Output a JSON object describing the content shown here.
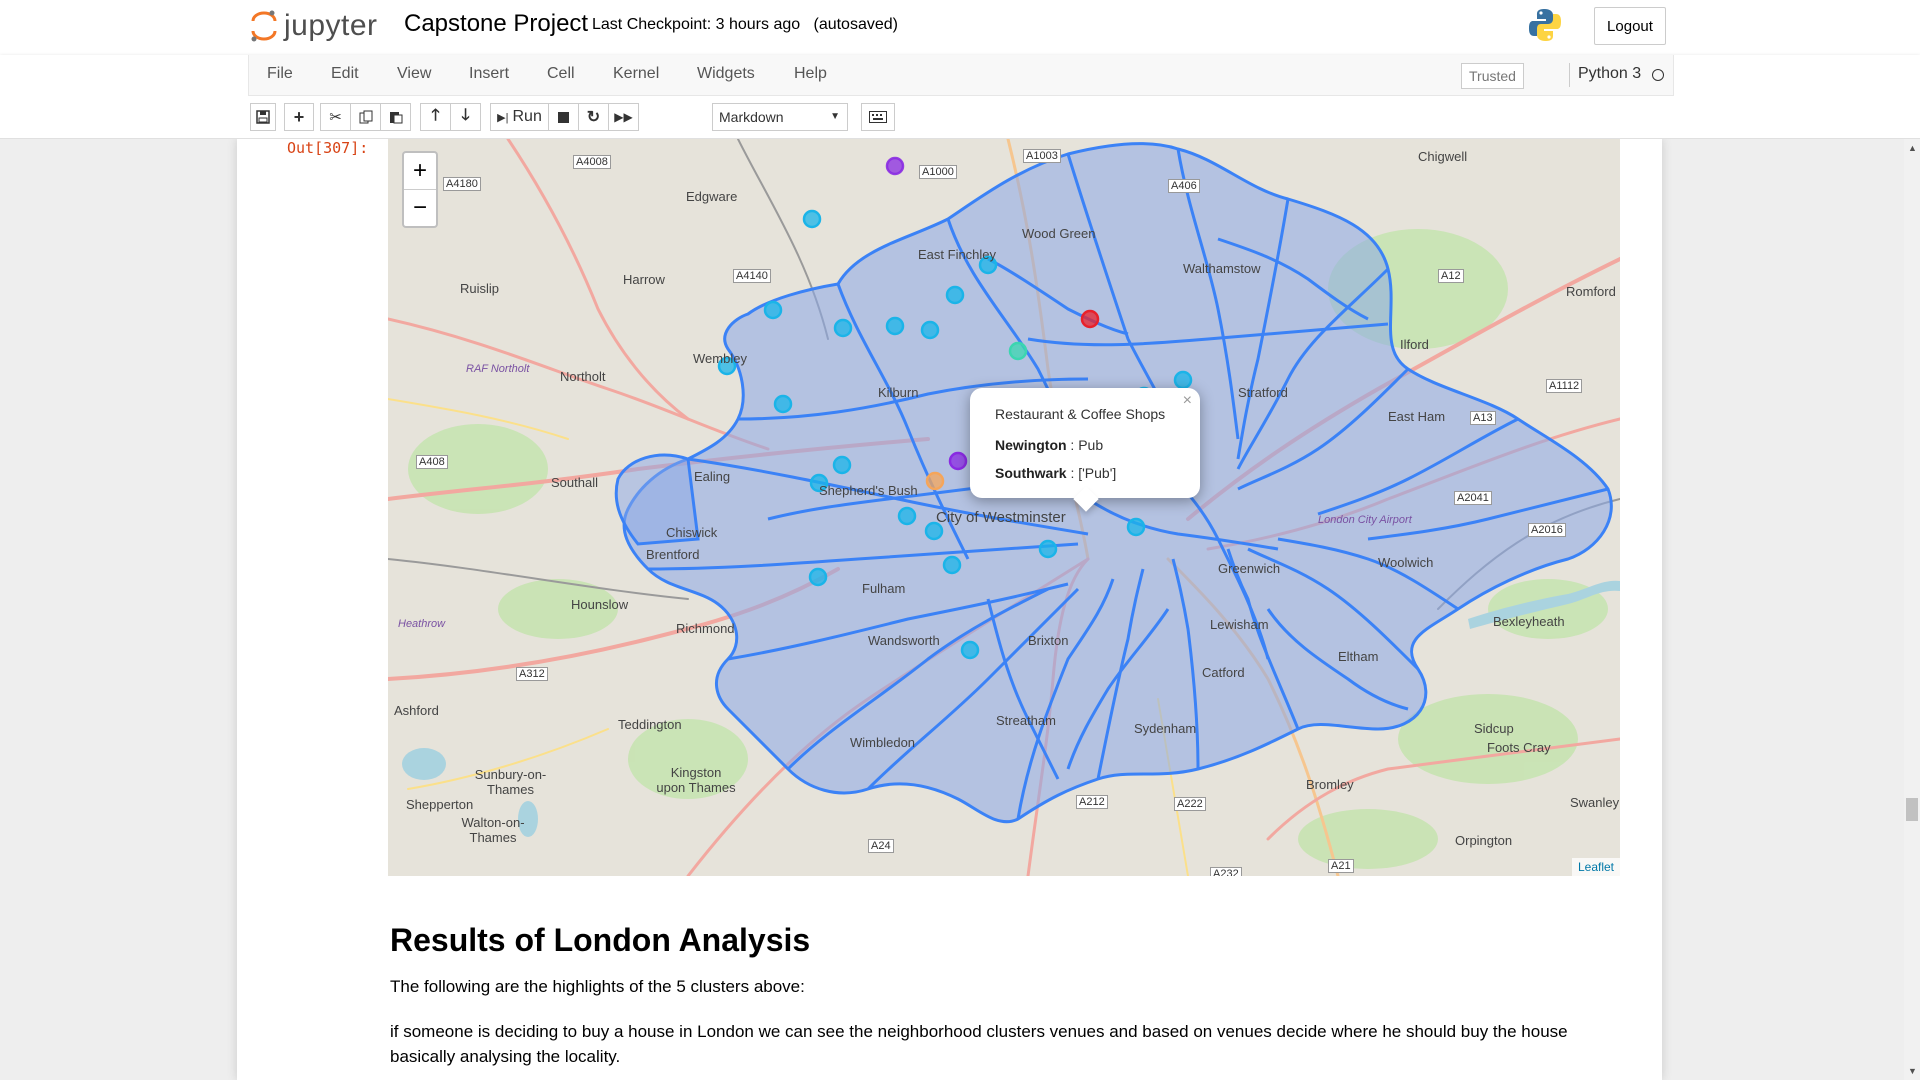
{
  "header": {
    "logo_text": "jupyter",
    "notebook_title": "Capstone Project",
    "checkpoint": "Last Checkpoint: 3 hours ago",
    "autosave": "(autosaved)",
    "logout_label": "Logout"
  },
  "menu": {
    "items": [
      "File",
      "Edit",
      "View",
      "Insert",
      "Cell",
      "Kernel",
      "Widgets",
      "Help"
    ],
    "trusted_label": "Trusted",
    "kernel_name": "Python 3"
  },
  "toolbar": {
    "run_label": "Run",
    "cell_type": "Markdown",
    "icons": [
      "save-icon",
      "plus-icon",
      "cut-icon",
      "copy-icon",
      "paste-icon",
      "arrow-up-icon",
      "arrow-down-icon",
      "run-icon",
      "stop-icon",
      "restart-icon",
      "fast-forward-icon",
      "keyboard-icon"
    ]
  },
  "output": {
    "prompt": "Out[307]:"
  },
  "map": {
    "zoom_in": "+",
    "zoom_out": "−",
    "attribution": "Leaflet",
    "popup": {
      "close": "×",
      "title": "Restaurant & Coffee Shops",
      "rows": [
        {
          "key": "Newington",
          "value": " : Pub"
        },
        {
          "key": "Southwark",
          "value": " : ['Pub']"
        }
      ]
    },
    "place_labels": [
      "Edgware",
      "Chigwell",
      "East Finchley",
      "Wood Green",
      "Walthamstow",
      "Harrow",
      "Ruislip",
      "Romford",
      "Wembley",
      "RAF Northolt",
      "Northolt",
      "Ilford",
      "Kilburn",
      "Stratford",
      "East Ham",
      "Ealing",
      "Southall",
      "Shepherd's Bush",
      "City of Westminster",
      "Chiswick",
      "Brentford",
      "Greenwich",
      "Woolwich",
      "London City Airport",
      "Fulham",
      "Hounslow",
      "Heathrow",
      "Richmond",
      "Lewisham",
      "Bexleyheath",
      "Eltham",
      "Wandsworth",
      "Brixton",
      "Catford",
      "Ashford",
      "Teddington",
      "Streatham",
      "Sydenham",
      "Sidcup",
      "Foots Cray",
      "Wimbledon",
      "Kingston upon Thames",
      "Sunbury-on-Thames",
      "Bromley",
      "Shepperton",
      "Walton-on-Thames",
      "Swanley",
      "Orpington"
    ],
    "road_labels": [
      "A4008",
      "A1000",
      "A406",
      "A4180",
      "A4140",
      "A12",
      "A1112",
      "A13",
      "A408",
      "A2041",
      "A2016",
      "A312",
      "A222",
      "A212",
      "A24",
      "A21",
      "A232",
      "A1003"
    ],
    "markers": [
      {
        "color": "#8a2be2"
      },
      {
        "color": "#1bb4e8"
      },
      {
        "color": "#1bb4e8"
      },
      {
        "color": "#1bb4e8"
      },
      {
        "color": "#1bb4e8"
      },
      {
        "color": "#1bb4e8"
      },
      {
        "color": "#1bb4e8"
      },
      {
        "color": "#e8212b"
      },
      {
        "color": "#1bb4e8"
      },
      {
        "color": "#1bb4e8"
      },
      {
        "color": "#1bb4e8"
      },
      {
        "color": "#1bb4e8"
      },
      {
        "color": "#8a2be2"
      },
      {
        "color": "#f5a55a"
      },
      {
        "color": "#1bb4e8"
      },
      {
        "color": "#1bb4e8"
      },
      {
        "color": "#1bb4e8"
      },
      {
        "color": "#1bb4e8"
      },
      {
        "color": "#1bb4e8"
      },
      {
        "color": "#1bb4e8"
      },
      {
        "color": "#1bb4e8"
      },
      {
        "color": "#1bb4e8"
      },
      {
        "color": "#1bb4e8"
      },
      {
        "color": "#3bd6b0"
      },
      {
        "color": "#1bb4e8"
      }
    ]
  },
  "results": {
    "heading": "Results of London Analysis",
    "paragraph1": "The following are the highlights of the 5 clusters above:",
    "paragraph2": "if someone is deciding to buy a house in London we can see the neighborhood clusters venues and based on venues decide where he should buy the house basically analysing the locality."
  },
  "colors": {
    "prompt_red": "#d84315",
    "boundary_blue": "#3b82f6",
    "region_fill": "#8aa8e8",
    "leaflet_link": "#0078a8"
  }
}
